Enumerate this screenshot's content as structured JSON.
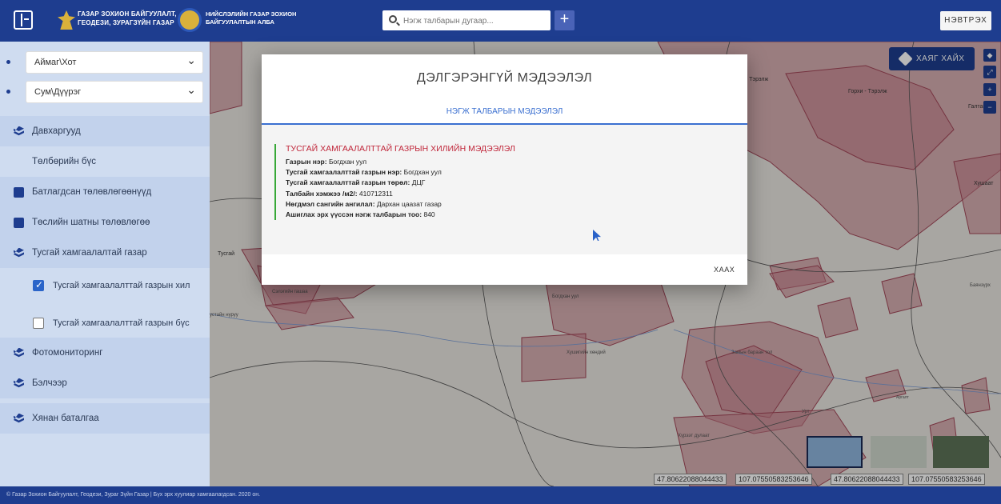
{
  "header": {
    "agency_line1": "ГАЗАР ЗОХИОН БАЙГУУЛАЛТ,",
    "agency_line2": "ГЕОДЕЗИ, ЗУРАГЗҮЙН ГАЗАР",
    "office_line1": "НИЙСЛЭЛИЙН ГАЗАР ЗОХИОН",
    "office_line2": "БАЙГУУЛАЛТЫН АЛБА",
    "search_placeholder": "Нэгж талбарын дугаар...",
    "add_label": "+",
    "login_label": "НЭВТРЭХ"
  },
  "sidebar": {
    "province_select": "Аймаг\\Хот",
    "district_select": "Сум\\Дүүрэг",
    "items": [
      {
        "label": "Давхаргууд"
      },
      {
        "label": "Төлбөрийн бүс"
      },
      {
        "label": "Батлагдсан төлөвлөгөөнүүд"
      },
      {
        "label": "Төслийн шатны төлөвлөгөө"
      },
      {
        "label": "Тусгай хамгаалалтай газар"
      },
      {
        "label": "Фотомониторинг"
      },
      {
        "label": "Бэлчээр"
      },
      {
        "label": "Хянан баталгаа"
      }
    ],
    "sub_items": [
      {
        "label": "Тусгай хамгаалалттай газрын хил",
        "checked": true
      },
      {
        "label": "Тусгай хамгаалалттай газрын бүс",
        "checked": false
      }
    ]
  },
  "map": {
    "labels": [
      "- Тэрэлж",
      "Горхи - Тэрэлж",
      "Галтай б",
      "Хушаат",
      "Тусгай",
      "Баянзүрх",
      "Сэлэгийн гашаа",
      "Богдхан уул",
      "устайн нуруу",
      "Хушигийн хөндий",
      "Замын бараан тол",
      "Хүрээт дулаат",
      "Аргалт",
      "Урт"
    ],
    "address_search_label": "ХАЯГ ХАЙХ",
    "coords": [
      "47.80622088044433",
      "107.07550583253646",
      "47.80622088044433",
      "107.07550583253646"
    ]
  },
  "modal": {
    "title": "ДЭЛГЭРЭНГҮЙ МЭДЭЭЛЭЛ",
    "tab": "НЭГЖ ТАЛБАРЫН МЭДЭЭЛЭЛ",
    "section_title": "ТУСГАЙ ХАМГААЛАЛТТАЙ ГАЗРЫН ХИЛИЙН МЭДЭЭЛЭЛ",
    "rows": [
      {
        "label": "Газрын нэр:",
        "value": "Богдхан уул"
      },
      {
        "label": "Тусгай хамгаалалттай газрын нэр:",
        "value": "Богдхан уул"
      },
      {
        "label": "Тусгай хамгаалалттай газрын төрөл:",
        "value": "ДЦГ"
      },
      {
        "label": "Талбайн хэмжээ /м2/:",
        "value": "410712311"
      },
      {
        "label": "Нөгдмэл сангийн ангилал:",
        "value": "Дархан цаазат газар"
      },
      {
        "label": "Ашиглах эрх үүссэн нэгж талбарын тоо:",
        "value": "840"
      }
    ],
    "close_label": "ХААХ"
  },
  "footer": {
    "text": "© Газар Зохион Байгуулалт, Геодези, Зураг Зүйн Газар | Бүх эрх хуулиар хамгаалагдсан. 2020 он."
  },
  "colors": {
    "header_bg": "#1e3d8f",
    "sidebar_bg": "#cfdcf0",
    "polygon_fill": "#c77f8a",
    "accent_blue": "#3a6fd0",
    "section_title_red": "#c0263a"
  }
}
